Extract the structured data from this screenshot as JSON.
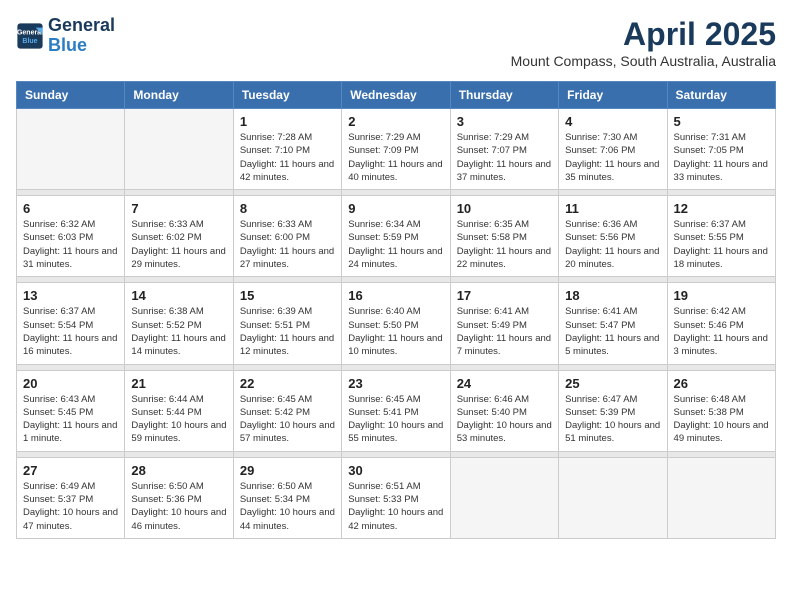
{
  "header": {
    "logo_line1": "General",
    "logo_line2": "Blue",
    "month": "April 2025",
    "location": "Mount Compass, South Australia, Australia"
  },
  "weekdays": [
    "Sunday",
    "Monday",
    "Tuesday",
    "Wednesday",
    "Thursday",
    "Friday",
    "Saturday"
  ],
  "weeks": [
    [
      {
        "day": "",
        "sunrise": "",
        "sunset": "",
        "daylight": ""
      },
      {
        "day": "",
        "sunrise": "",
        "sunset": "",
        "daylight": ""
      },
      {
        "day": "1",
        "sunrise": "Sunrise: 7:28 AM",
        "sunset": "Sunset: 7:10 PM",
        "daylight": "Daylight: 11 hours and 42 minutes."
      },
      {
        "day": "2",
        "sunrise": "Sunrise: 7:29 AM",
        "sunset": "Sunset: 7:09 PM",
        "daylight": "Daylight: 11 hours and 40 minutes."
      },
      {
        "day": "3",
        "sunrise": "Sunrise: 7:29 AM",
        "sunset": "Sunset: 7:07 PM",
        "daylight": "Daylight: 11 hours and 37 minutes."
      },
      {
        "day": "4",
        "sunrise": "Sunrise: 7:30 AM",
        "sunset": "Sunset: 7:06 PM",
        "daylight": "Daylight: 11 hours and 35 minutes."
      },
      {
        "day": "5",
        "sunrise": "Sunrise: 7:31 AM",
        "sunset": "Sunset: 7:05 PM",
        "daylight": "Daylight: 11 hours and 33 minutes."
      }
    ],
    [
      {
        "day": "6",
        "sunrise": "Sunrise: 6:32 AM",
        "sunset": "Sunset: 6:03 PM",
        "daylight": "Daylight: 11 hours and 31 minutes."
      },
      {
        "day": "7",
        "sunrise": "Sunrise: 6:33 AM",
        "sunset": "Sunset: 6:02 PM",
        "daylight": "Daylight: 11 hours and 29 minutes."
      },
      {
        "day": "8",
        "sunrise": "Sunrise: 6:33 AM",
        "sunset": "Sunset: 6:00 PM",
        "daylight": "Daylight: 11 hours and 27 minutes."
      },
      {
        "day": "9",
        "sunrise": "Sunrise: 6:34 AM",
        "sunset": "Sunset: 5:59 PM",
        "daylight": "Daylight: 11 hours and 24 minutes."
      },
      {
        "day": "10",
        "sunrise": "Sunrise: 6:35 AM",
        "sunset": "Sunset: 5:58 PM",
        "daylight": "Daylight: 11 hours and 22 minutes."
      },
      {
        "day": "11",
        "sunrise": "Sunrise: 6:36 AM",
        "sunset": "Sunset: 5:56 PM",
        "daylight": "Daylight: 11 hours and 20 minutes."
      },
      {
        "day": "12",
        "sunrise": "Sunrise: 6:37 AM",
        "sunset": "Sunset: 5:55 PM",
        "daylight": "Daylight: 11 hours and 18 minutes."
      }
    ],
    [
      {
        "day": "13",
        "sunrise": "Sunrise: 6:37 AM",
        "sunset": "Sunset: 5:54 PM",
        "daylight": "Daylight: 11 hours and 16 minutes."
      },
      {
        "day": "14",
        "sunrise": "Sunrise: 6:38 AM",
        "sunset": "Sunset: 5:52 PM",
        "daylight": "Daylight: 11 hours and 14 minutes."
      },
      {
        "day": "15",
        "sunrise": "Sunrise: 6:39 AM",
        "sunset": "Sunset: 5:51 PM",
        "daylight": "Daylight: 11 hours and 12 minutes."
      },
      {
        "day": "16",
        "sunrise": "Sunrise: 6:40 AM",
        "sunset": "Sunset: 5:50 PM",
        "daylight": "Daylight: 11 hours and 10 minutes."
      },
      {
        "day": "17",
        "sunrise": "Sunrise: 6:41 AM",
        "sunset": "Sunset: 5:49 PM",
        "daylight": "Daylight: 11 hours and 7 minutes."
      },
      {
        "day": "18",
        "sunrise": "Sunrise: 6:41 AM",
        "sunset": "Sunset: 5:47 PM",
        "daylight": "Daylight: 11 hours and 5 minutes."
      },
      {
        "day": "19",
        "sunrise": "Sunrise: 6:42 AM",
        "sunset": "Sunset: 5:46 PM",
        "daylight": "Daylight: 11 hours and 3 minutes."
      }
    ],
    [
      {
        "day": "20",
        "sunrise": "Sunrise: 6:43 AM",
        "sunset": "Sunset: 5:45 PM",
        "daylight": "Daylight: 11 hours and 1 minute."
      },
      {
        "day": "21",
        "sunrise": "Sunrise: 6:44 AM",
        "sunset": "Sunset: 5:44 PM",
        "daylight": "Daylight: 10 hours and 59 minutes."
      },
      {
        "day": "22",
        "sunrise": "Sunrise: 6:45 AM",
        "sunset": "Sunset: 5:42 PM",
        "daylight": "Daylight: 10 hours and 57 minutes."
      },
      {
        "day": "23",
        "sunrise": "Sunrise: 6:45 AM",
        "sunset": "Sunset: 5:41 PM",
        "daylight": "Daylight: 10 hours and 55 minutes."
      },
      {
        "day": "24",
        "sunrise": "Sunrise: 6:46 AM",
        "sunset": "Sunset: 5:40 PM",
        "daylight": "Daylight: 10 hours and 53 minutes."
      },
      {
        "day": "25",
        "sunrise": "Sunrise: 6:47 AM",
        "sunset": "Sunset: 5:39 PM",
        "daylight": "Daylight: 10 hours and 51 minutes."
      },
      {
        "day": "26",
        "sunrise": "Sunrise: 6:48 AM",
        "sunset": "Sunset: 5:38 PM",
        "daylight": "Daylight: 10 hours and 49 minutes."
      }
    ],
    [
      {
        "day": "27",
        "sunrise": "Sunrise: 6:49 AM",
        "sunset": "Sunset: 5:37 PM",
        "daylight": "Daylight: 10 hours and 47 minutes."
      },
      {
        "day": "28",
        "sunrise": "Sunrise: 6:50 AM",
        "sunset": "Sunset: 5:36 PM",
        "daylight": "Daylight: 10 hours and 46 minutes."
      },
      {
        "day": "29",
        "sunrise": "Sunrise: 6:50 AM",
        "sunset": "Sunset: 5:34 PM",
        "daylight": "Daylight: 10 hours and 44 minutes."
      },
      {
        "day": "30",
        "sunrise": "Sunrise: 6:51 AM",
        "sunset": "Sunset: 5:33 PM",
        "daylight": "Daylight: 10 hours and 42 minutes."
      },
      {
        "day": "",
        "sunrise": "",
        "sunset": "",
        "daylight": ""
      },
      {
        "day": "",
        "sunrise": "",
        "sunset": "",
        "daylight": ""
      },
      {
        "day": "",
        "sunrise": "",
        "sunset": "",
        "daylight": ""
      }
    ]
  ]
}
